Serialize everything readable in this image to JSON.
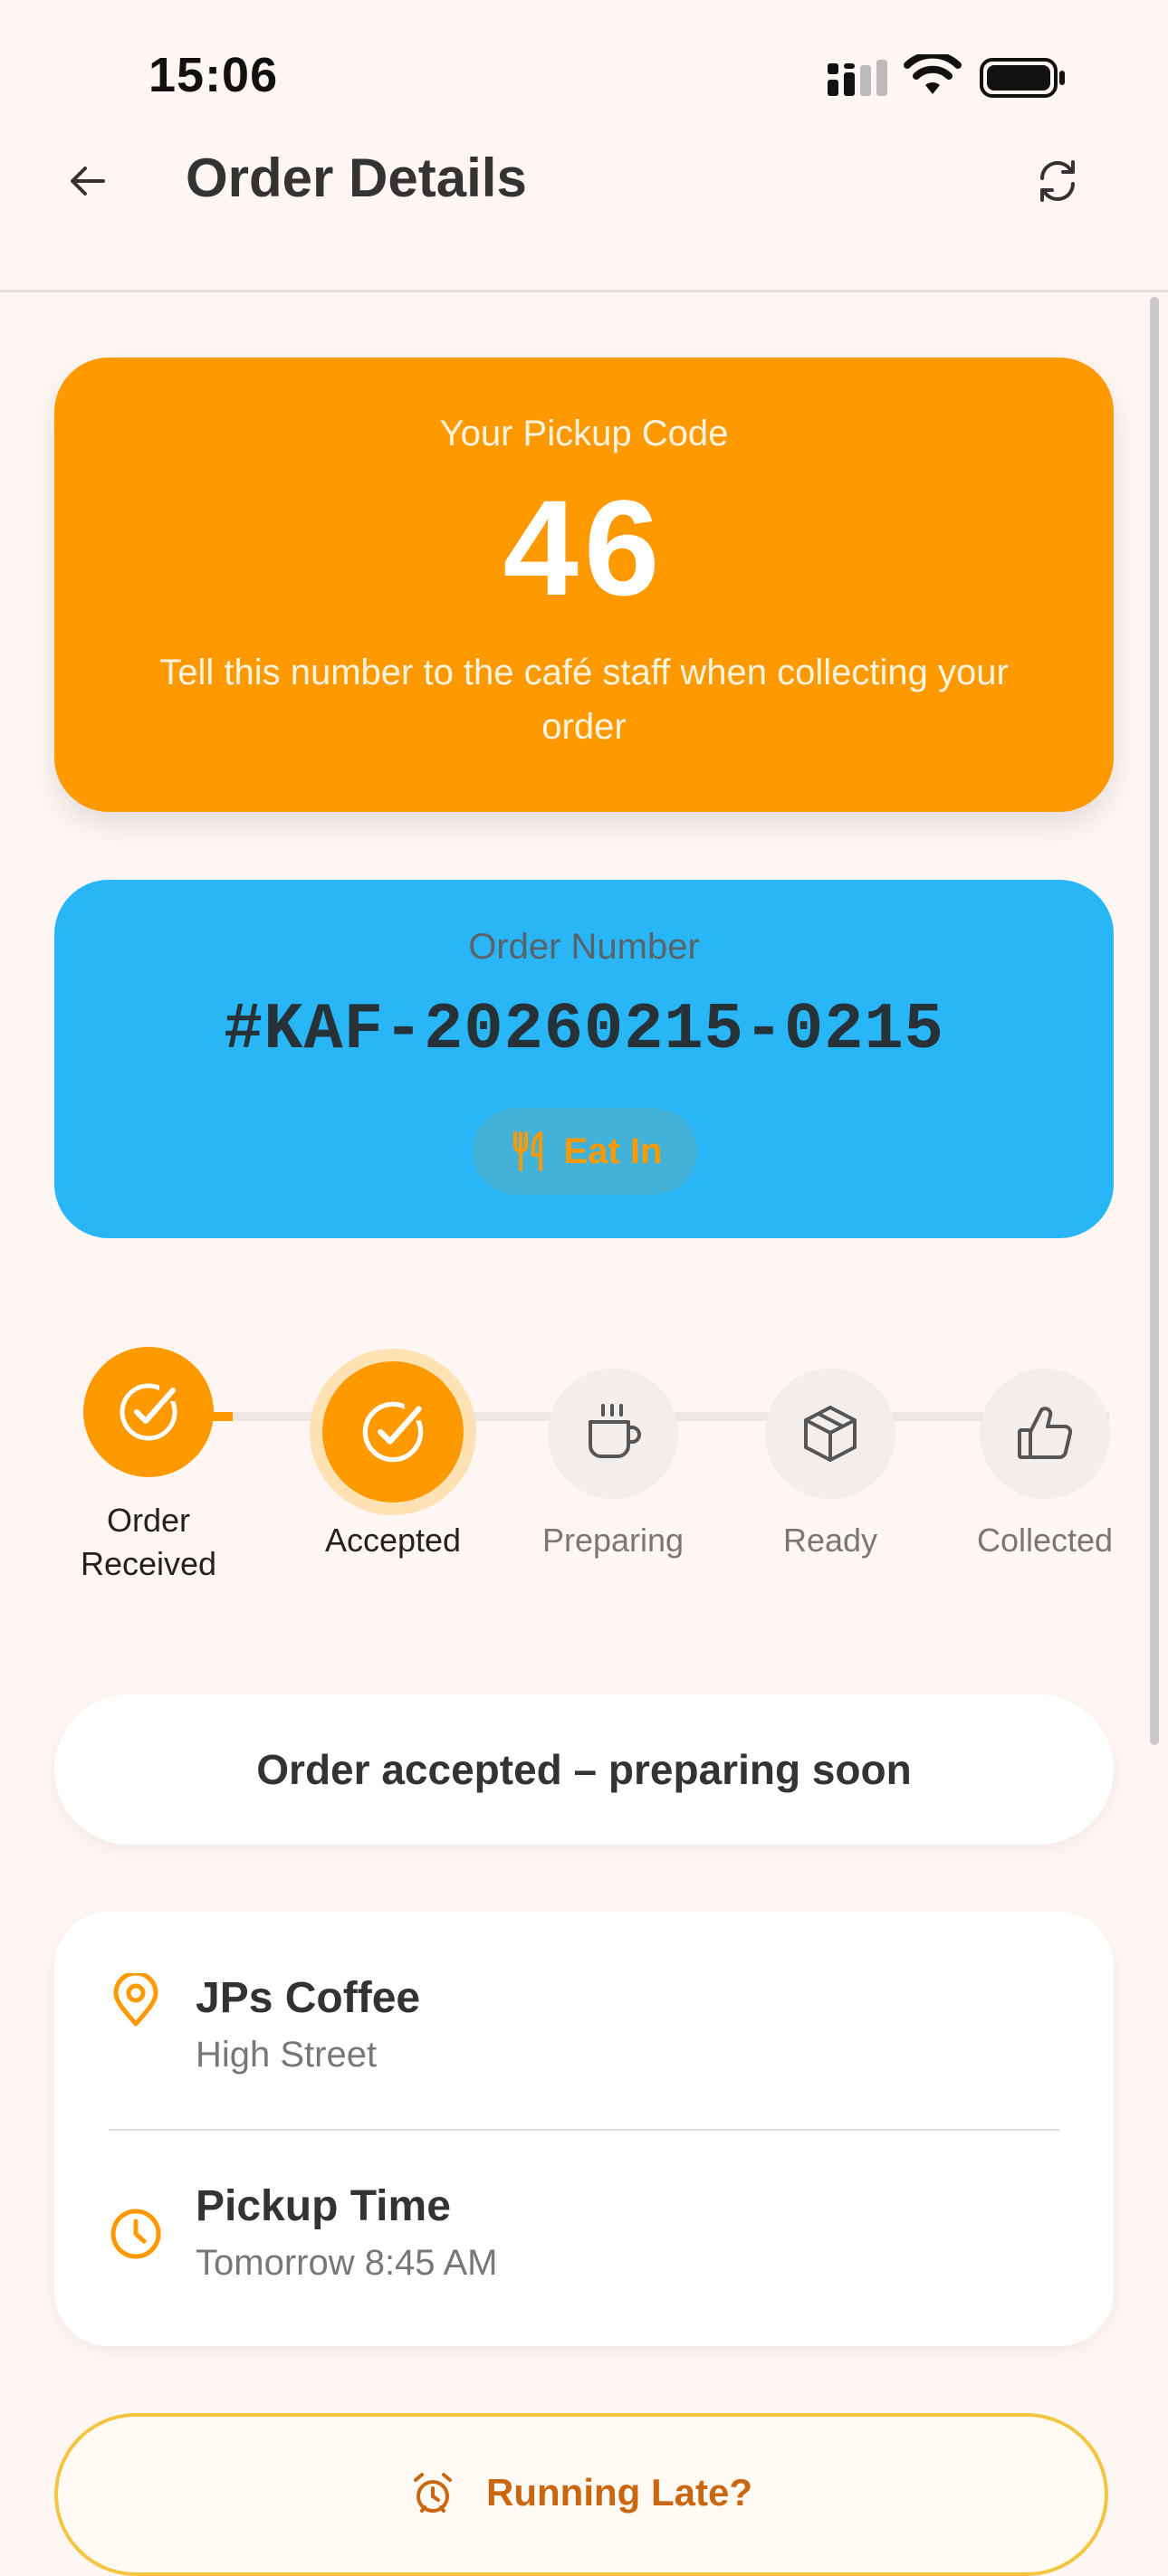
{
  "status_bar": {
    "time": "15:06"
  },
  "header": {
    "title": "Order Details",
    "back_icon": "arrow-left-icon",
    "refresh_icon": "refresh-icon"
  },
  "pickup": {
    "label": "Your Pickup Code",
    "code": "46",
    "hint": "Tell this number to the café staff when collecting your order"
  },
  "order": {
    "label": "Order Number",
    "number": "#KAF-20260215-0215",
    "type_label": "Eat In",
    "type_icon": "cutlery-icon"
  },
  "progress": {
    "steps": [
      {
        "label": "Order Received",
        "state": "done",
        "icon": "check-icon"
      },
      {
        "label": "Accepted",
        "state": "current",
        "icon": "check-icon"
      },
      {
        "label": "Preparing",
        "state": "pending",
        "icon": "coffee-cup-icon"
      },
      {
        "label": "Ready",
        "state": "pending",
        "icon": "box-icon"
      },
      {
        "label": "Collected",
        "state": "pending",
        "icon": "thumbs-up-icon"
      }
    ]
  },
  "status_message": "Order accepted – preparing soon",
  "location": {
    "name": "JPs Coffee",
    "address": "High Street",
    "icon": "map-pin-icon"
  },
  "pickup_time": {
    "label": "Pickup Time",
    "value": "Tomorrow 8:45 AM",
    "icon": "clock-icon"
  },
  "late_button": {
    "label": "Running Late?",
    "icon": "alarm-clock-icon"
  },
  "colors": {
    "accent": "#ff9900",
    "blue": "#29b6f6",
    "background": "#fdf6f2",
    "late_text": "#c9660f"
  }
}
